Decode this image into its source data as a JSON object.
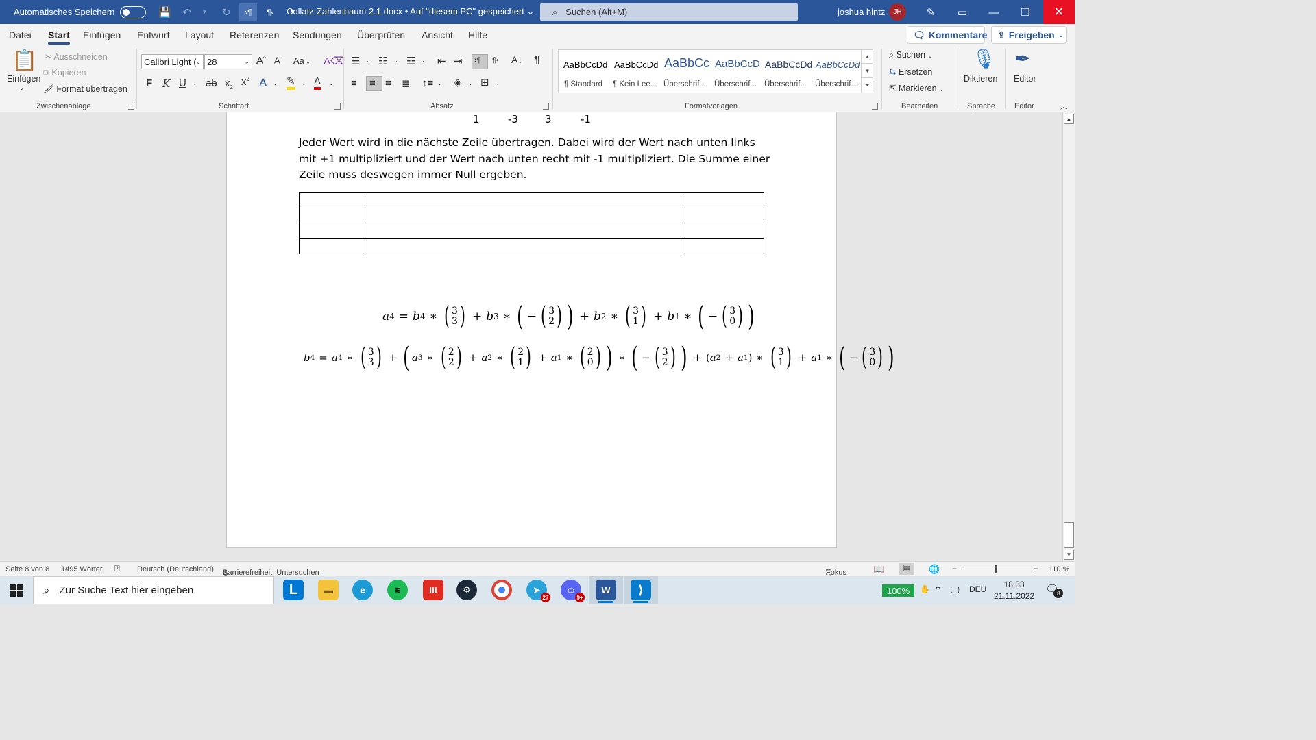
{
  "titlebar": {
    "autosave_label": "Automatisches Speichern",
    "doc_title": "Collatz-Zahlenbaum 2.1.docx • Auf \"diesem PC\" gespeichert",
    "search_placeholder": "Suchen (Alt+M)",
    "user_name": "joshua hintz",
    "user_initials": "JH"
  },
  "menu": {
    "tabs": [
      "Datei",
      "Start",
      "Einfügen",
      "Entwurf",
      "Layout",
      "Referenzen",
      "Sendungen",
      "Überprüfen",
      "Ansicht",
      "Hilfe"
    ],
    "comments_label": "Kommentare",
    "share_label": "Freigeben"
  },
  "ribbon": {
    "clipboard": {
      "paste_label": "Einfügen",
      "cut_label": "Ausschneiden",
      "copy_label": "Kopieren",
      "format_painter_label": "Format übertragen",
      "group_label": "Zwischenablage"
    },
    "font": {
      "font_name": "Calibri Light (",
      "font_size": "28",
      "case_label": "Aa",
      "bold": "F",
      "italic": "K",
      "underline": "U",
      "strike": "ab",
      "subscript": "x",
      "superscript": "x",
      "group_label": "Schriftart"
    },
    "paragraph": {
      "group_label": "Absatz"
    },
    "styles": {
      "items": [
        {
          "sample": "AaBbCcDd",
          "name": "¶ Standard"
        },
        {
          "sample": "AaBbCcDd",
          "name": "¶ Kein Lee..."
        },
        {
          "sample": "AaBbCc",
          "name": "Überschrif..."
        },
        {
          "sample": "AaBbCcD",
          "name": "Überschrif..."
        },
        {
          "sample": "AaBbCcDd",
          "name": "Überschrif..."
        },
        {
          "sample": "AaBbCcDd",
          "name": "Überschrif..."
        }
      ],
      "group_label": "Formatvorlagen"
    },
    "editing": {
      "find_label": "Suchen",
      "replace_label": "Ersetzen",
      "select_label": "Markieren",
      "group_label": "Bearbeiten"
    },
    "voice": {
      "dictate_label": "Diktieren",
      "group_label": "Sprache"
    },
    "editor": {
      "editor_label": "Editor",
      "group_label": "Editor"
    }
  },
  "document": {
    "numbers": [
      "1",
      "-3",
      "3",
      "-1"
    ],
    "paragraph": "Jeder Wert wird in die nächste Zeile übertragen. Dabei wird der Wert nach unten links mit +1 multipliziert und der Wert nach unten recht mit -1 multipliziert. Die Summe einer Zeile muss deswegen immer Null ergeben.",
    "table_rows": 4,
    "table_cols": 3
  },
  "statusbar": {
    "page": "Seite 8 von 8",
    "words": "1495 Wörter",
    "language": "Deutsch (Deutschland)",
    "accessibility": "Barrierefreiheit: Untersuchen",
    "focus": "Fokus",
    "zoom": "110 %"
  },
  "taskbar": {
    "search_placeholder": "Zur Suche Text hier eingeben",
    "battery": "100%",
    "language": "DEU",
    "time": "18:33",
    "date": "21.11.2022",
    "telegram_badge": "27",
    "discord_badge": "9+",
    "notification_badge": "8"
  },
  "colors": {
    "word_blue": "#2b579a",
    "close_red": "#e81123",
    "battery_green": "#1ea54b"
  }
}
